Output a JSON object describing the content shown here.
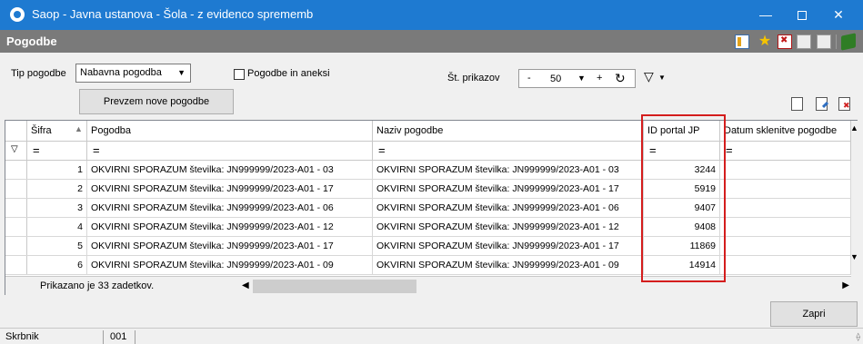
{
  "window": {
    "title": "Saop  - Javna ustanova - Šola - z evidenco sprememb",
    "minimize": "—",
    "close": "✕"
  },
  "form": {
    "title": "Pogodbe",
    "tip_label": "Tip pogodbe",
    "tip_value": "Nabavna pogodba",
    "aneksi_label": "Pogodbe in aneksi",
    "prevzem_button": "Prevzem nove pogodbe",
    "prikazov_label": "Št. prikazov",
    "prikazov_minus": "-",
    "prikazov_value": "50",
    "prikazov_plus": "+"
  },
  "icons": {
    "star": "★",
    "dropdown": "▼",
    "refresh": "↻",
    "filter": "▽",
    "left_arrow": "◀",
    "right_arrow": "▶",
    "up_arrow": "▲",
    "down_arrow": "▼",
    "grip": "⟠"
  },
  "grid": {
    "columns": [
      "Šifra",
      "Pogodba",
      "Naziv pogodbe",
      "ID portal JP",
      "Datum sklenitve pogodbe"
    ],
    "filter_symbol": "=",
    "rows": [
      {
        "sifra": "1",
        "pogodba": "OKVIRNI SPORAZUM številka: JN999999/2023-A01 - 03",
        "naziv": "OKVIRNI SPORAZUM številka: JN999999/2023-A01 - 03",
        "id_portal": "3244",
        "datum": ""
      },
      {
        "sifra": "2",
        "pogodba": "OKVIRNI SPORAZUM številka: JN999999/2023-A01 - 17",
        "naziv": "OKVIRNI SPORAZUM številka: JN999999/2023-A01 - 17",
        "id_portal": "5919",
        "datum": ""
      },
      {
        "sifra": "3",
        "pogodba": "OKVIRNI SPORAZUM številka: JN999999/2023-A01 - 06",
        "naziv": "OKVIRNI SPORAZUM številka: JN999999/2023-A01 - 06",
        "id_portal": "9407",
        "datum": ""
      },
      {
        "sifra": "4",
        "pogodba": "OKVIRNI SPORAZUM številka: JN999999/2023-A01 - 12",
        "naziv": "OKVIRNI SPORAZUM številka: JN999999/2023-A01 - 12",
        "id_portal": "9408",
        "datum": ""
      },
      {
        "sifra": "5",
        "pogodba": "OKVIRNI SPORAZUM številka: JN999999/2023-A01 - 17",
        "naziv": "OKVIRNI SPORAZUM številka: JN999999/2023-A01 - 17",
        "id_portal": "11869",
        "datum": ""
      },
      {
        "sifra": "6",
        "pogodba": "OKVIRNI SPORAZUM številka: JN999999/2023-A01 - 09",
        "naziv": "OKVIRNI SPORAZUM številka: JN999999/2023-A01 - 09",
        "id_portal": "14914",
        "datum": ""
      }
    ],
    "count_text": "Prikazano je 33 zadetkov."
  },
  "buttons": {
    "zapri": "Zapri"
  },
  "status": {
    "user": "Skrbnik",
    "code": "001"
  },
  "colors": {
    "titlebar": "#1e7ad1",
    "header": "#7a7a7a",
    "highlight": "#d41d1d"
  }
}
